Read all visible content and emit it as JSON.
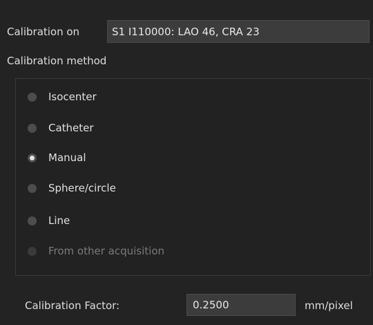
{
  "calibration_on": {
    "label": "Calibration on",
    "source_value": "S1 I110000: LAO 46, CRA 23"
  },
  "method": {
    "title": "Calibration method",
    "options": [
      {
        "label": "Isocenter",
        "selected": false,
        "enabled": true
      },
      {
        "label": "Catheter",
        "selected": false,
        "enabled": true
      },
      {
        "label": "Manual",
        "selected": true,
        "enabled": true
      },
      {
        "label": "Sphere/circle",
        "selected": false,
        "enabled": true
      },
      {
        "label": "Line",
        "selected": false,
        "enabled": true
      },
      {
        "label": "From other acquisition",
        "selected": false,
        "enabled": false
      }
    ]
  },
  "factor": {
    "label": "Calibration Factor:",
    "value": "0.2500",
    "unit": "mm/pixel"
  },
  "colors": {
    "background": "#232323",
    "field_background": "#3c3c3c",
    "text": "#dcdcdc",
    "disabled_text": "#7a7a7a"
  },
  "icons": {
    "radio_unchecked": "radio-unchecked-icon",
    "radio_checked": "radio-checked-icon"
  }
}
